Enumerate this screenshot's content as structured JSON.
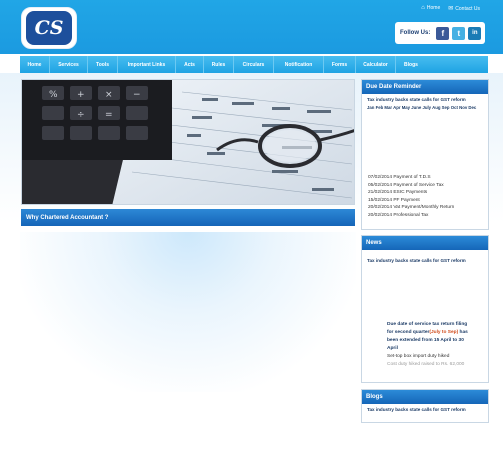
{
  "header": {
    "logo_text": "CS",
    "top_links": [
      {
        "icon": "home-icon",
        "label": "Home"
      },
      {
        "icon": "mail-icon",
        "label": "Contact Us"
      }
    ],
    "follow_label": "Follow Us:",
    "social": [
      {
        "name": "facebook",
        "glyph": "f",
        "color": "#3b5998"
      },
      {
        "name": "twitter",
        "glyph": "t",
        "color": "#45b0e3"
      },
      {
        "name": "linkedin",
        "glyph": "in",
        "color": "#1b7bb5"
      }
    ]
  },
  "nav": {
    "items": [
      "Home",
      "Services",
      "Tools",
      "Important Links",
      "Acts",
      "Rules",
      "Circulars",
      "Notification",
      "Forms",
      "Calculator",
      "Blogs"
    ]
  },
  "main": {
    "why_title": "Why Chartered Accountant ?"
  },
  "due_date": {
    "title": "Due Date Reminder",
    "headline": "Tax industry backs state calls for GST reform",
    "months": "Jan Feb Mar Apr May June July Aug Sep Oct Nov Dec",
    "items": [
      "07/02/2014 Payment of T.D.S",
      "05/02/2014 Payment of Service Tax",
      "21/02/2014 ESIC Payments",
      "15/02/2014 PF Payment",
      "20/02/2014 Vat Payment/Monthly Return",
      "20/02/2014 Professional Tax"
    ]
  },
  "news": {
    "title": "News",
    "headline": "Tax industry backs state calls for GST reform",
    "body_line1": "Due date of service tax return filing",
    "body_line2_pre": "for second quarter",
    "body_line2_hl": "(July to Sep)",
    "body_line2_post": " has",
    "body_line3": "been extended from 15 April to 30",
    "body_line4": "April",
    "body_line5": "Set-top box import duty hiked",
    "body_line6": "Cost duty hiked raised to Rs. 62,000"
  },
  "blogs": {
    "title": "Blogs",
    "headline": "Tax industry backs state calls for GST reform"
  }
}
